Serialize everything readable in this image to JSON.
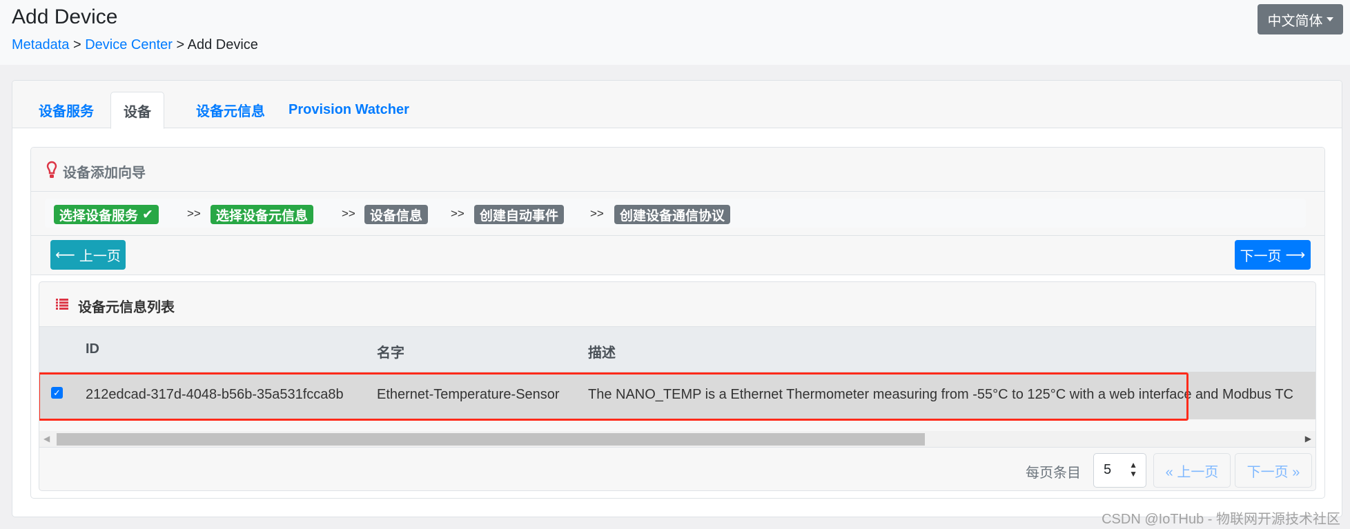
{
  "header": {
    "title": "Add Device",
    "breadcrumb": [
      "Metadata",
      "Device Center",
      "Add Device"
    ],
    "separator": ">",
    "language": "中文简体"
  },
  "tabs": [
    {
      "label": "设备服务"
    },
    {
      "label": "设备",
      "active": true
    },
    {
      "label": "设备元信息"
    },
    {
      "label": "Provision Watcher"
    }
  ],
  "wizard": {
    "title": "设备添加向导",
    "icon": "lightbulb-icon",
    "steps": [
      {
        "label": "选择设备服务",
        "done": true
      },
      {
        "label": "选择设备元信息",
        "done": false,
        "current": true
      },
      {
        "label": "设备信息"
      },
      {
        "label": "创建自动事件"
      },
      {
        "label": "创建设备通信协议"
      }
    ],
    "separator": ">>",
    "prev_label": "上一页",
    "next_label": "下一页"
  },
  "table": {
    "title": "设备元信息列表",
    "columns": [
      "ID",
      "名字",
      "描述"
    ],
    "rows": [
      {
        "checked": true,
        "id": "212edcad-317d-4048-b56b-35a531fcca8b",
        "name": "Ethernet-Temperature-Sensor",
        "description": "The NANO_TEMP is a Ethernet Thermometer measuring from -55°C to 125°C with a web interface and Modbus TC"
      }
    ],
    "page_size_label": "每页条目",
    "page_size": "5",
    "prev_label": "« 上一页",
    "next_label": "下一页 »"
  },
  "colors": {
    "primary": "#007bff",
    "success": "#28a745",
    "secondary": "#6c757d",
    "info": "#17a2b8",
    "highlight": "#ff2a1a"
  },
  "watermark": "CSDN @IoTHub - 物联网开源技术社区"
}
